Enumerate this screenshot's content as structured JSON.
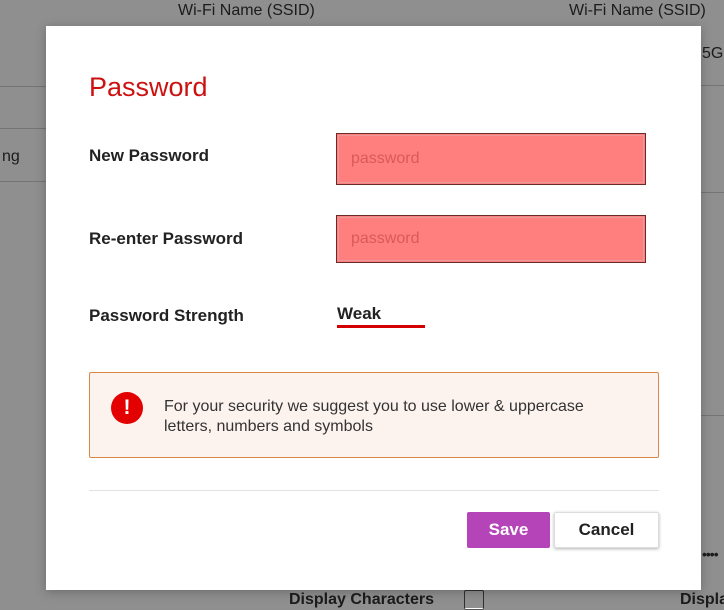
{
  "background": {
    "column_header_left": "Wi-Fi Name (SSID)",
    "column_header_right": "Wi-Fi Name (SSID)",
    "band_fragment": "5G",
    "row_fragment": "ng",
    "display_characters_label": "Display Characters",
    "display_fragment": "Displa",
    "password_dots": "••••"
  },
  "modal": {
    "title": "Password",
    "new_password": {
      "label": "New Password",
      "placeholder": "password"
    },
    "reenter_password": {
      "label": "Re-enter Password",
      "placeholder": "password"
    },
    "strength": {
      "label": "Password Strength",
      "value": "Weak",
      "status_color": "#d40000"
    },
    "notice": {
      "icon": "exclamation-icon",
      "text": "For your security we suggest you to use lower & uppercase letters, numbers and symbols"
    },
    "buttons": {
      "save_label": "Save",
      "cancel_label": "Cancel"
    }
  },
  "colors": {
    "title": "#cc1111",
    "error_field": "#ff7f7f",
    "save_button": "#b544b8",
    "notice_border": "#d9884a"
  }
}
